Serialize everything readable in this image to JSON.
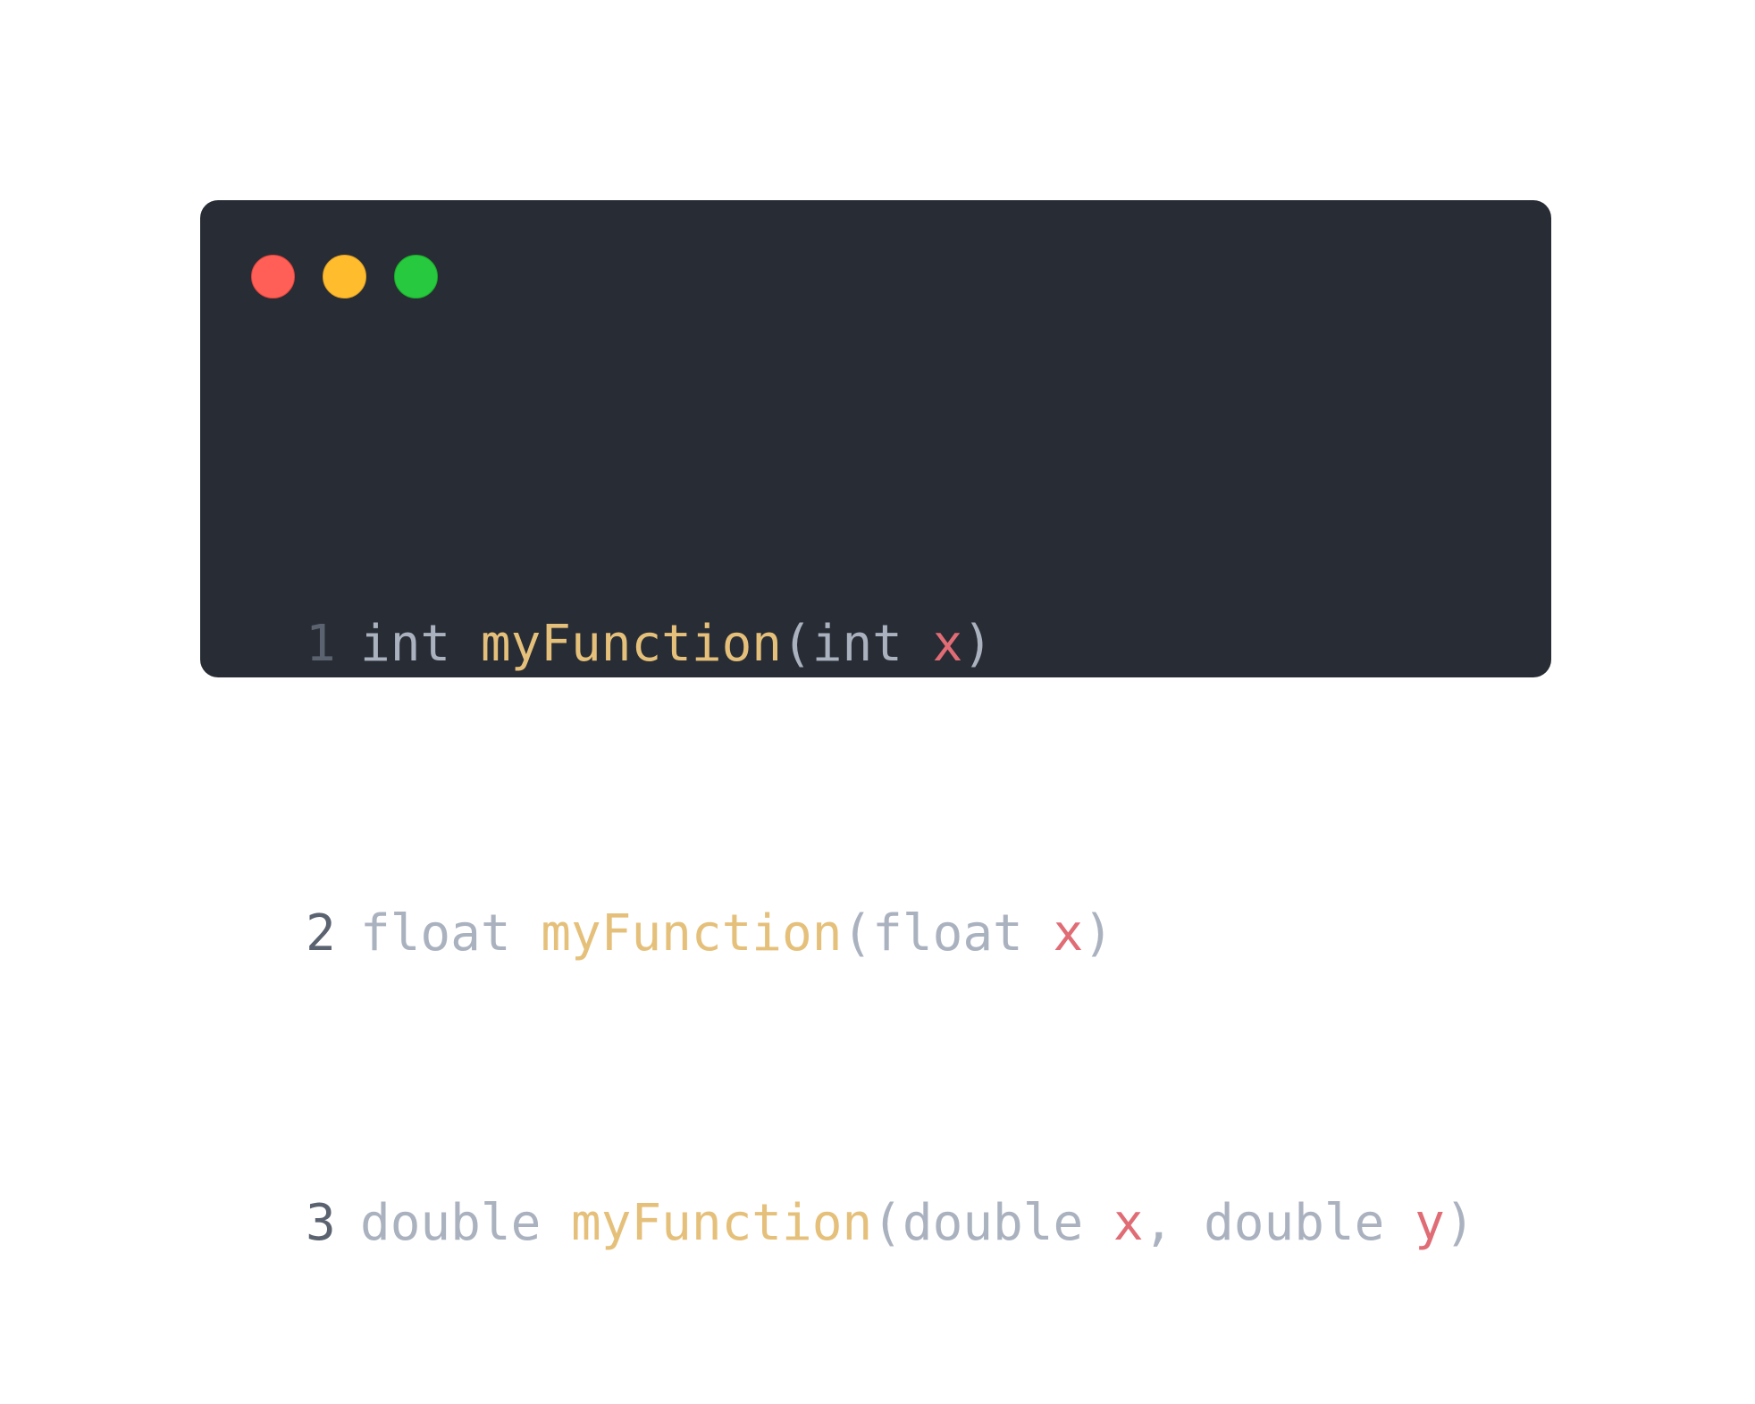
{
  "window": {
    "controls": [
      {
        "name": "close",
        "color": "#ff5f56"
      },
      {
        "name": "minimize",
        "color": "#ffbd2e"
      },
      {
        "name": "maximize",
        "color": "#27c93f"
      }
    ]
  },
  "code": {
    "lines": [
      {
        "number": "1",
        "tokens": [
          {
            "type": "keyword",
            "text": "int"
          },
          {
            "type": "space",
            "text": " "
          },
          {
            "type": "function",
            "text": "myFunction"
          },
          {
            "type": "punc",
            "text": "("
          },
          {
            "type": "keyword",
            "text": "int"
          },
          {
            "type": "space",
            "text": " "
          },
          {
            "type": "variable",
            "text": "x"
          },
          {
            "type": "punc",
            "text": ")"
          }
        ]
      },
      {
        "number": "2",
        "tokens": [
          {
            "type": "keyword",
            "text": "float"
          },
          {
            "type": "space",
            "text": " "
          },
          {
            "type": "function",
            "text": "myFunction"
          },
          {
            "type": "punc",
            "text": "("
          },
          {
            "type": "keyword",
            "text": "float"
          },
          {
            "type": "space",
            "text": " "
          },
          {
            "type": "variable",
            "text": "x"
          },
          {
            "type": "punc",
            "text": ")"
          }
        ]
      },
      {
        "number": "3",
        "tokens": [
          {
            "type": "keyword",
            "text": "double"
          },
          {
            "type": "space",
            "text": " "
          },
          {
            "type": "function",
            "text": "myFunction"
          },
          {
            "type": "punc",
            "text": "("
          },
          {
            "type": "keyword",
            "text": "double"
          },
          {
            "type": "space",
            "text": " "
          },
          {
            "type": "variable",
            "text": "x"
          },
          {
            "type": "punc",
            "text": ", "
          },
          {
            "type": "keyword",
            "text": "double"
          },
          {
            "type": "space",
            "text": " "
          },
          {
            "type": "variable",
            "text": "y"
          },
          {
            "type": "punc",
            "text": ")"
          }
        ]
      }
    ]
  },
  "theme": {
    "background": "#282c34",
    "keyword": "#abb2bf",
    "function": "#e5c07b",
    "variable": "#e06c75",
    "line_number": "#5c6370"
  }
}
